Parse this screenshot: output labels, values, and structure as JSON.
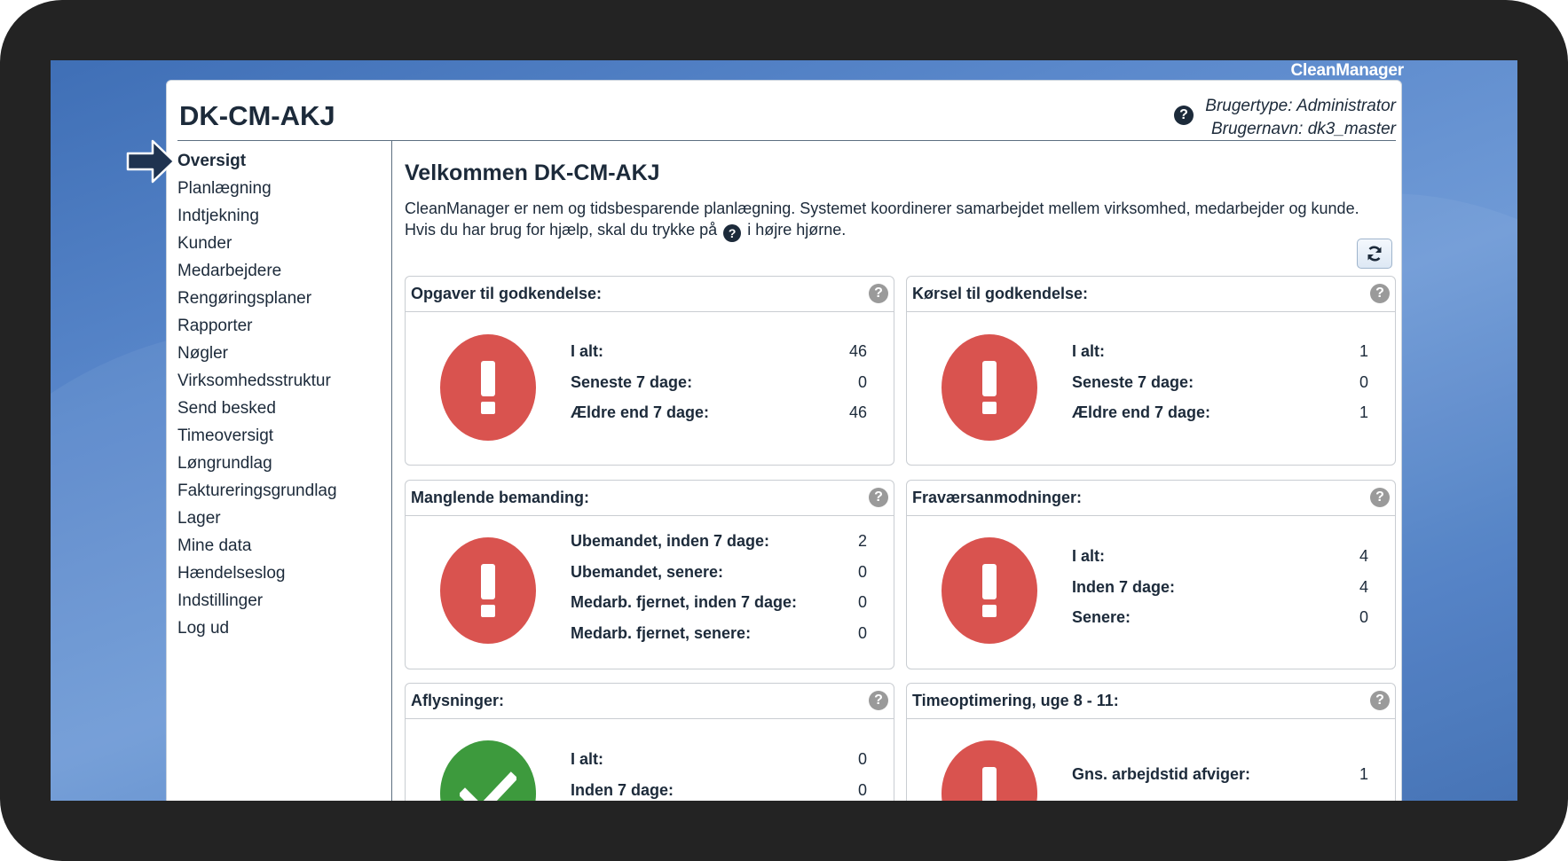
{
  "brand": "CleanManager",
  "site_title": "DK-CM-AKJ",
  "user": {
    "type_line": "Brugertype: Administrator",
    "name_line": "Brugernavn: dk3_master"
  },
  "nav": [
    "Oversigt",
    "Planlægning",
    "Indtjekning",
    "Kunder",
    "Medarbejdere",
    "Rengøringsplaner",
    "Rapporter",
    "Nøgler",
    "Virksomhedsstruktur",
    "Send besked",
    "Timeoversigt",
    "Løngrundlag",
    "Faktureringsgrundlag",
    "Lager",
    "Mine data",
    "Hændelseslog",
    "Indstillinger",
    "Log ud"
  ],
  "active_nav": "Oversigt",
  "welcome": {
    "title": "Velkommen DK-CM-AKJ",
    "line1": "CleanManager er nem og tidsbesparende planlægning. Systemet koordinerer samarbejdet mellem virksomhed, medarbejder og kunde.",
    "line2_before": "Hvis du har brug for hjælp, skal du trykke på",
    "line2_after": "i højre hjørne."
  },
  "cards": {
    "opgaver": {
      "title": "Opgaver til godkendelse:",
      "status": "alert",
      "rows": [
        {
          "label": "I alt:",
          "value": "46"
        },
        {
          "label": "Seneste 7 dage:",
          "value": "0"
        },
        {
          "label": "Ældre end 7 dage:",
          "value": "46"
        }
      ]
    },
    "korsel": {
      "title": "Kørsel til godkendelse:",
      "status": "alert",
      "rows": [
        {
          "label": "I alt:",
          "value": "1"
        },
        {
          "label": "Seneste 7 dage:",
          "value": "0"
        },
        {
          "label": "Ældre end 7 dage:",
          "value": "1"
        }
      ]
    },
    "bemanding": {
      "title": "Manglende bemanding:",
      "status": "alert",
      "rows": [
        {
          "label": "Ubemandet, inden 7 dage:",
          "value": "2"
        },
        {
          "label": "Ubemandet, senere:",
          "value": "0"
        },
        {
          "label": "Medarb. fjernet, inden 7 dage:",
          "value": "0"
        },
        {
          "label": "Medarb. fjernet, senere:",
          "value": "0"
        }
      ]
    },
    "fravaer": {
      "title": "Fraværsanmodninger:",
      "status": "alert",
      "rows": [
        {
          "label": "I alt:",
          "value": "4"
        },
        {
          "label": "Inden 7 dage:",
          "value": "4"
        },
        {
          "label": "Senere:",
          "value": "0"
        }
      ]
    },
    "aflysninger": {
      "title": "Aflysninger:",
      "status": "ok",
      "rows": [
        {
          "label": "I alt:",
          "value": "0"
        },
        {
          "label": "Inden 7 dage:",
          "value": "0"
        }
      ]
    },
    "timeopt": {
      "title": "Timeoptimering, uge 8 - 11:",
      "status": "alert",
      "rows": [
        {
          "label": "Gns. arbejdstid afviger:",
          "value": "1"
        }
      ]
    }
  },
  "colors": {
    "alert": "#d9534f",
    "ok": "#3d9a3d",
    "text": "#1c2a3a",
    "desktop": "#5a88cb"
  }
}
